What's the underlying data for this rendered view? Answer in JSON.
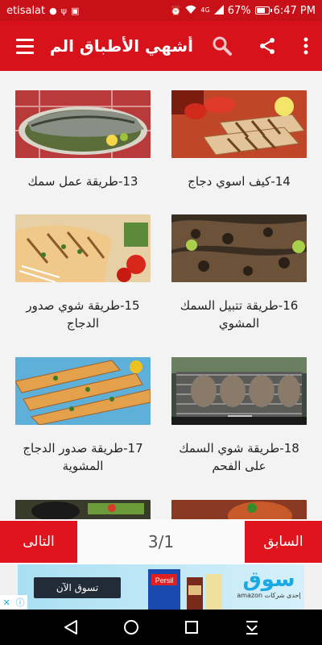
{
  "status_bar": {
    "carrier": "etisalat",
    "network": "4G",
    "battery": "67%",
    "battery_level": 0.67,
    "time": "6:47 PM"
  },
  "app_bar": {
    "title": "أشهي الأطباق الم...",
    "icons": [
      "menu-icon",
      "search-icon",
      "share-icon",
      "more-vert-icon"
    ]
  },
  "cards": [
    {
      "label": "14-كيف اسوي دجاج",
      "image": "grilled-chicken"
    },
    {
      "label": "13-طريقة عمل سمك",
      "image": "grilled-fish-plate"
    },
    {
      "label": "16-طريقة تتبيل السمك المشوي",
      "image": "seasoned-grilled-fish"
    },
    {
      "label": "15-طريقة شوي صدور الدجاج",
      "image": "grilled-chicken-breast"
    },
    {
      "label": "18-طريقة شوي السمك على الفحم",
      "image": "fish-on-charcoal-grill"
    },
    {
      "label": "17-طريقة صدور الدجاج المشوية",
      "image": "chicken-skewers"
    },
    {
      "label": "",
      "image": "partial-dish"
    },
    {
      "label": "",
      "image": "partial-dish-2"
    }
  ],
  "pager": {
    "next_label": "التالى",
    "prev_label": "السابق",
    "page": "3/1"
  },
  "ad": {
    "cta": "تسوق الآن",
    "brand": "سوق",
    "sub": "إحدى شركات amazon",
    "product": "Persil"
  },
  "colors": {
    "primary": "#d7121b",
    "status_bar": "#c81018",
    "nav_bar": "#000000"
  }
}
